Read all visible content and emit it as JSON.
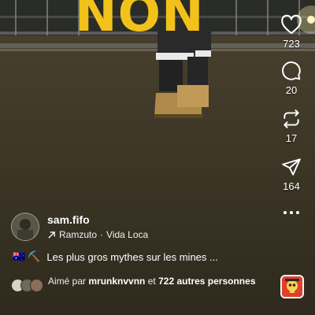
{
  "overlay": {
    "title": "NON"
  },
  "author": {
    "username": "sam.fifo"
  },
  "audio": {
    "artist": "Ramzuto",
    "separator": "·",
    "track": "Vida Loca"
  },
  "caption": {
    "emojis": [
      "🇦🇺",
      "⛏️"
    ],
    "text": "Les plus gros mythes sur les mines ..."
  },
  "likes": {
    "prefix": "Aimé par",
    "user": "mrunknvvnn",
    "joiner": "et",
    "others": "722 autres personnes"
  },
  "actions": {
    "like": {
      "icon": "heart-icon",
      "count": "723"
    },
    "comment": {
      "icon": "comment-icon",
      "count": "20"
    },
    "repost": {
      "icon": "repost-icon",
      "count": "17"
    },
    "share": {
      "icon": "send-icon",
      "count": "164"
    },
    "more": {
      "icon": "more-icon"
    }
  },
  "colors": {
    "overlay_text": "#f2c21a",
    "audio_thumb": "#e0402a",
    "background": "#3a3324"
  }
}
